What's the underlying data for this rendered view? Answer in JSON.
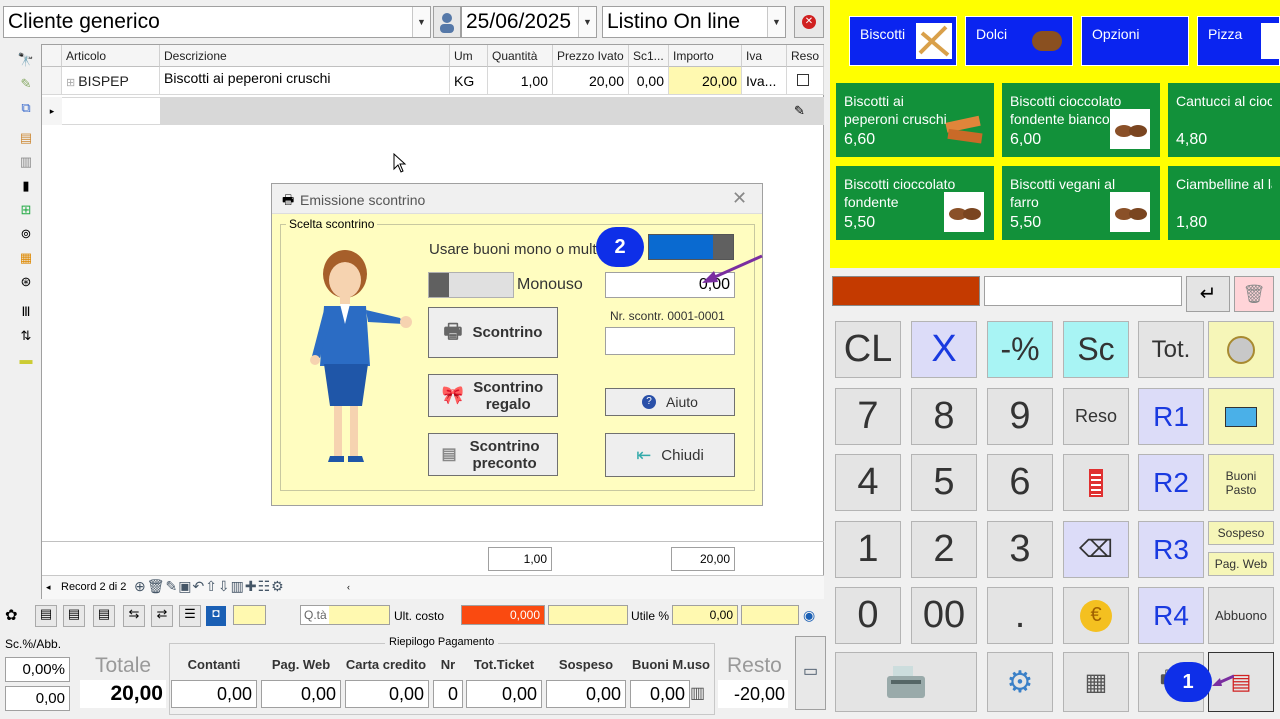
{
  "header": {
    "customer": "Cliente generico",
    "date": "25/06/2025",
    "price_list": "Listino On line"
  },
  "grid": {
    "columns": [
      "Articolo",
      "Descrizione",
      "Um",
      "Quantità",
      "Prezzo Ivato",
      "Sc1...",
      "Importo",
      "Iva",
      "Reso"
    ],
    "row": {
      "article": "BISPEP",
      "description": "Biscotti ai peperoni cruschi",
      "um": "KG",
      "quantity": "1,00",
      "price": "20,00",
      "discount": "0,00",
      "amount": "20,00",
      "vat": "Iva..."
    },
    "total_quantity": "1,00",
    "total_amount": "20,00",
    "record_nav": "Record 2 di 2"
  },
  "dialog": {
    "title": "Emissione scontrino",
    "group": "Scelta scontrino",
    "toggle_label": "Usare buoni mono o multi",
    "monouso_label": "Monouso",
    "monouso_value": "0,00",
    "receipt_number_label": "Nr. scontr. 0001-0001",
    "btn_scontrino": "Scontrino",
    "btn_regalo": "Scontrino regalo",
    "btn_preconto": "Scontrino preconto",
    "btn_aiuto": "Aiuto",
    "btn_chiudi": "Chiudi"
  },
  "status_bar": {
    "qty_label": "Q.tà",
    "cost_label": "Ult. costo",
    "cost_value": "0,000",
    "margin_label": "Utile %",
    "margin_value": "0,00"
  },
  "summary": {
    "discount_label": "Sc.%/Abb.",
    "discount_pct": "0,00%",
    "discount_value": "0,00",
    "total_label": "Totale",
    "total": "20,00",
    "payment_title": "Riepilogo Pagamento",
    "payments": [
      {
        "label": "Contanti",
        "value": "0,00"
      },
      {
        "label": "Pag. Web",
        "value": "0,00"
      },
      {
        "label": "Carta credito",
        "value": "0,00"
      },
      {
        "label": "Nr",
        "value": "0"
      },
      {
        "label": "Tot.Ticket",
        "value": "0,00"
      },
      {
        "label": "Sospeso",
        "value": "0,00"
      },
      {
        "label": "Buoni M.uso",
        "value": "0,00"
      }
    ],
    "rest_label": "Resto",
    "rest": "-20,00"
  },
  "categories": [
    "Biscotti",
    "Dolci",
    "Opzioni",
    "Pizza"
  ],
  "products": [
    {
      "name": "Biscotti ai peperoni cruschi",
      "price": "6,60"
    },
    {
      "name": "Biscotti cioccolato fondente bianco",
      "price": "6,00"
    },
    {
      "name": "Cantucci al cioc",
      "price": "4,80"
    },
    {
      "name": "Biscotti cioccolato fondente",
      "price": "5,50"
    },
    {
      "name": "Biscotti vegani al farro",
      "price": "5,50"
    },
    {
      "name": "Ciambelline al la",
      "price": "1,80"
    }
  ],
  "keypad": {
    "cl": "CL",
    "x": "X",
    "pct": "-%",
    "sc": "Sc",
    "tot": "Tot.",
    "reso": "Reso",
    "r1": "R1",
    "r2": "R2",
    "r3": "R3",
    "r4": "R4",
    "buoni_pasto": "Buoni Pasto",
    "sospeso": "Sospeso",
    "pag_web": "Pag. Web",
    "abbuono": "Abbuono",
    "d7": "7",
    "d8": "8",
    "d9": "9",
    "d4": "4",
    "d5": "5",
    "d6": "6",
    "d1": "1",
    "d2": "2",
    "d3": "3",
    "d0": "0",
    "d00": "00",
    "dot": "."
  },
  "badges": {
    "one": "1",
    "two": "2"
  },
  "colors": {
    "tile_green": "#12913a",
    "category_blue": "#0a24f0",
    "dialog_bg": "#fffdc0",
    "badge_blue": "#0e2fe8",
    "arrow_purple": "#7a2ea0"
  }
}
